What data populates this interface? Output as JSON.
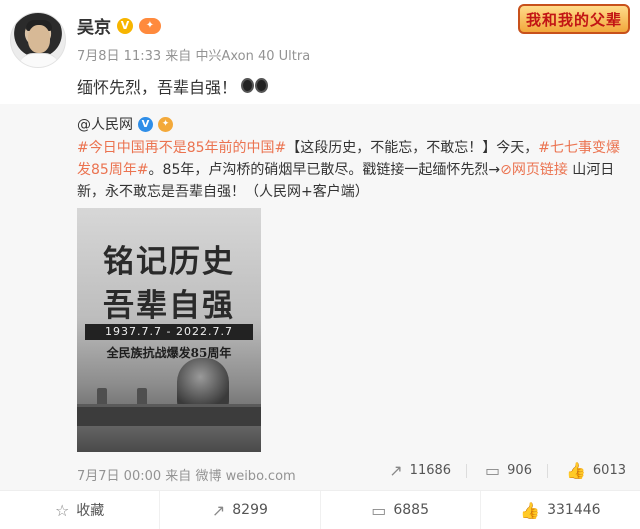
{
  "author": {
    "name": "吴京",
    "vip_badge": "V",
    "level_badge": "✦"
  },
  "meta": {
    "timestamp": "7月8日 11:33",
    "source_prefix": "来自",
    "source": "中兴Axon 40 Ultra"
  },
  "post_text": "缅怀先烈，吾辈自强！",
  "brand_badge": "我和我的父辈",
  "repost": {
    "author": "@人民网",
    "verified": "V",
    "badge": "✦",
    "topic1": "#今日中国再不是85年前的中国#",
    "text1": "【这段历史，不能忘，不敢忘！】今天，",
    "topic2": "#七七事变爆发85周年#",
    "text2": "。85年，卢沟桥的硝烟早已散尽。戳链接一起缅怀先烈→",
    "link_icon": "⊘",
    "link_text": "网页链接",
    "text3": " 山河日新，永不敢忘是吾辈自强！（人民网+客户端）",
    "poster": {
      "title_line1": "铭记历史",
      "title_line2": "吾辈自强",
      "dates": "1937.7.7 - 2022.7.7",
      "subtitle": "全民族抗战爆发85周年"
    },
    "timestamp": "7月7日 00:00",
    "source_prefix": "来自",
    "source": "微博 weibo.com",
    "stats": {
      "reposts": "11686",
      "comments": "906",
      "likes": "6013"
    }
  },
  "actions": {
    "favorite": "收藏",
    "repost": "8299",
    "comment": "6885",
    "like": "331446"
  },
  "icons": {
    "repost": "share-icon",
    "comment": "comment-icon",
    "like": "like-icon",
    "favorite": "star-icon"
  }
}
